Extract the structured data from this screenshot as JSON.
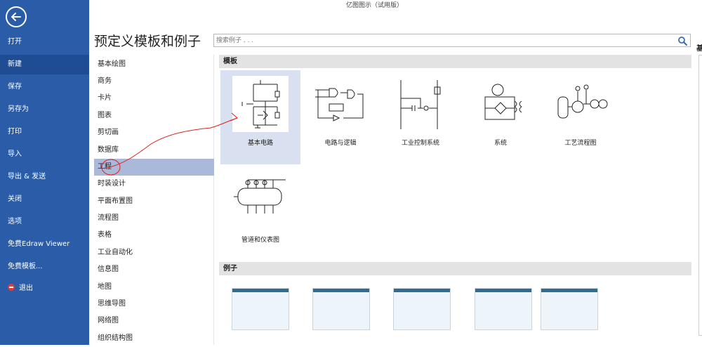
{
  "window": {
    "title": "亿图图示（试用版）"
  },
  "sidebar": {
    "back_label": "返回",
    "items": [
      {
        "label": "打开"
      },
      {
        "label": "新建"
      },
      {
        "label": "保存"
      },
      {
        "label": "另存为"
      },
      {
        "label": "打印"
      },
      {
        "label": "导入"
      },
      {
        "label": "导出 & 发送"
      },
      {
        "label": "关闭"
      },
      {
        "label": "选项"
      },
      {
        "label": "免费Edraw Viewer"
      },
      {
        "label": "免费模板..."
      },
      {
        "label": "退出",
        "icon": "exit-icon"
      }
    ]
  },
  "main": {
    "heading": "预定义模板和例子",
    "search_placeholder": "搜索例子 . . .",
    "categories": [
      {
        "label": "基本绘图"
      },
      {
        "label": "商务"
      },
      {
        "label": "卡片"
      },
      {
        "label": "图表"
      },
      {
        "label": "剪切画"
      },
      {
        "label": "数据库"
      },
      {
        "label": "工程",
        "selected": true
      },
      {
        "label": "时装设计"
      },
      {
        "label": "平面布置图"
      },
      {
        "label": "流程图"
      },
      {
        "label": "表格"
      },
      {
        "label": "工业自动化"
      },
      {
        "label": "信息图"
      },
      {
        "label": "地图"
      },
      {
        "label": "思维导图"
      },
      {
        "label": "网络图"
      },
      {
        "label": "组织结构图"
      }
    ],
    "templates_section": "模板",
    "templates": [
      {
        "label": "基本电路",
        "selected": true
      },
      {
        "label": "电路与逻辑"
      },
      {
        "label": "工业控制系统"
      },
      {
        "label": "系统"
      },
      {
        "label": "工艺流程图"
      },
      {
        "label": "管道和仪表图"
      }
    ],
    "examples_section": "例子"
  },
  "right_panel": {
    "title": "基"
  },
  "colors": {
    "sidebar": "#2a5ca8",
    "selection": "#aab8da",
    "annotation": "#e0201e"
  }
}
